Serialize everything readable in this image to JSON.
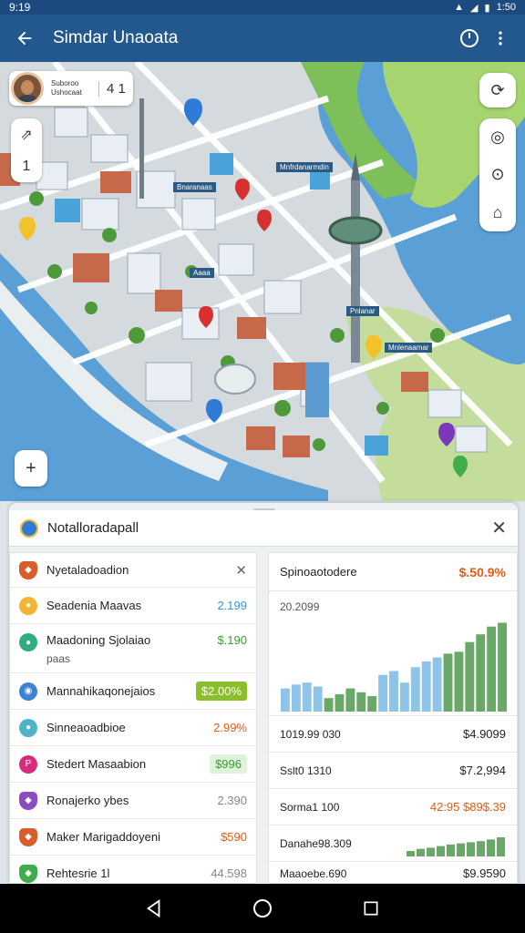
{
  "status_bar": {
    "time": "9:19",
    "battery": "1:50"
  },
  "app_bar": {
    "title": "Simdar Unaoata"
  },
  "map": {
    "user_name": "Suboroo Ushocaat",
    "user_count": "4  1",
    "left_control_top": "⇗",
    "left_control_bottom": "1",
    "zoom_label": "+",
    "label_tags": [
      "Mnfrdanarmdin",
      "Bnaranaas",
      "Pnlanar",
      "Mnlenaamar",
      "Aaaa"
    ]
  },
  "sheet": {
    "title": "Notalloradapall",
    "list": {
      "header": "Nyetaladoadion",
      "rows": [
        {
          "label": "Seadenia Maavas",
          "value": "2.199",
          "color": "#2f9ad6",
          "icon_color": "#f2b534",
          "icon": "chat-icon"
        },
        {
          "label": "Maadoning Sjolaiao",
          "sub": "paas",
          "value": "$.190",
          "color": "#3a9a3a",
          "icon_color": "#2fae7d",
          "icon": "chat-icon"
        },
        {
          "label": "Mannahikaqonejaios",
          "value": "$2.00%",
          "color": "#ffffff",
          "chip": "#8cbd2a",
          "icon_color": "#3a83d6",
          "icon": "globe-icon"
        },
        {
          "label": "Sinneaoadbioe",
          "value": "2.99%",
          "color": "#e85a14",
          "icon_color": "#4fb3c6",
          "icon": "chat-icon"
        },
        {
          "label": "Stedert Masaabion",
          "value": "$996",
          "color": "#3a9a3a",
          "chip": "#dff2da",
          "icon_color": "#d62c7d",
          "icon": "pin-icon"
        },
        {
          "label": "Ronajerko ybes",
          "value": "2.390",
          "color": "#888888",
          "icon_color": "#8a4cc0",
          "icon": "shield-icon"
        },
        {
          "label": "Maker Marigaddoyeni",
          "value": "$590",
          "color": "#e85a14",
          "icon_color": "#d85c2c",
          "icon": "shield-icon"
        },
        {
          "label": "Rehtesrie 1l",
          "value": "44.598",
          "color": "#888888",
          "icon_color": "#3fae4a",
          "icon": "shield-icon"
        }
      ]
    },
    "stats": {
      "title": "Spinoaotodere",
      "title_value": "$.50.9%",
      "subtitle": "20.2099",
      "rows": [
        {
          "label": "1019.99 030",
          "value": "$4.9099"
        },
        {
          "label": "Sslt0 1310",
          "value": "$7.2,994"
        },
        {
          "label": "Sorma1 100",
          "value": "42:95 $89$.39",
          "accent": "#e85a14"
        },
        {
          "label": "Danahe98.309",
          "value": ""
        },
        {
          "label": "Maaoebe.690",
          "value": "$9.9590"
        }
      ]
    }
  },
  "chart_data": [
    {
      "type": "bar",
      "title": "",
      "categories": [
        "1",
        "2",
        "3",
        "4",
        "5",
        "6",
        "7",
        "8",
        "9",
        "10",
        "11",
        "12",
        "13",
        "14",
        "15",
        "16",
        "17",
        "18",
        "19",
        "20",
        "21"
      ],
      "series": [
        {
          "values": [
            24,
            28,
            30,
            26,
            14,
            18,
            24,
            20,
            16,
            38,
            42,
            30,
            46,
            52,
            56,
            60,
            62,
            72,
            80,
            88,
            92
          ]
        }
      ],
      "colors": [
        "#8ec4e8",
        "#6aa868"
      ],
      "split_index": 15,
      "ylim": [
        0,
        100
      ]
    },
    {
      "type": "bar",
      "title": "",
      "categories": [
        "1",
        "2",
        "3",
        "4",
        "5",
        "6",
        "7",
        "8",
        "9",
        "10"
      ],
      "series": [
        {
          "values": [
            20,
            28,
            32,
            38,
            44,
            48,
            52,
            56,
            62,
            70
          ]
        }
      ],
      "colors": [
        "#6aa868"
      ],
      "ylim": [
        0,
        100
      ]
    }
  ]
}
